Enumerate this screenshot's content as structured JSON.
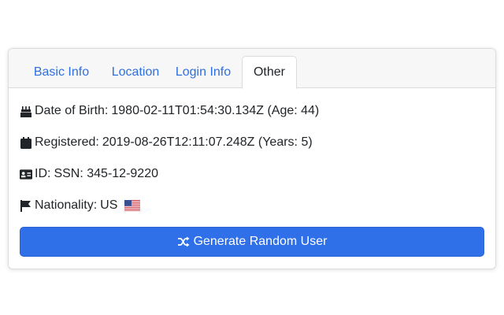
{
  "tabs": [
    {
      "label": "Basic Info",
      "active": false
    },
    {
      "label": "Location",
      "active": false
    },
    {
      "label": "Login Info",
      "active": false
    },
    {
      "label": "Other",
      "active": true
    }
  ],
  "details": {
    "dob": {
      "icon": "birthday-cake-icon",
      "label": "Date of Birth:",
      "value": "1980-02-11T01:54:30.134Z (Age: 44)"
    },
    "registered": {
      "icon": "calendar-icon",
      "label": "Registered:",
      "value": "2019-08-26T12:11:07.248Z (Years: 5)"
    },
    "id": {
      "icon": "id-card-icon",
      "label": "ID:",
      "value": "SSN: 345-12-9220"
    },
    "nationality": {
      "icon": "flag-icon",
      "label": "Nationality:",
      "value": "US",
      "flag_icon": "us-flag-icon"
    }
  },
  "generate_button": {
    "icon": "shuffle-icon",
    "label": "Generate Random User"
  },
  "colors": {
    "accent": "#2f6fe8",
    "tab_link": "#2f6fe0",
    "text": "#212529"
  }
}
